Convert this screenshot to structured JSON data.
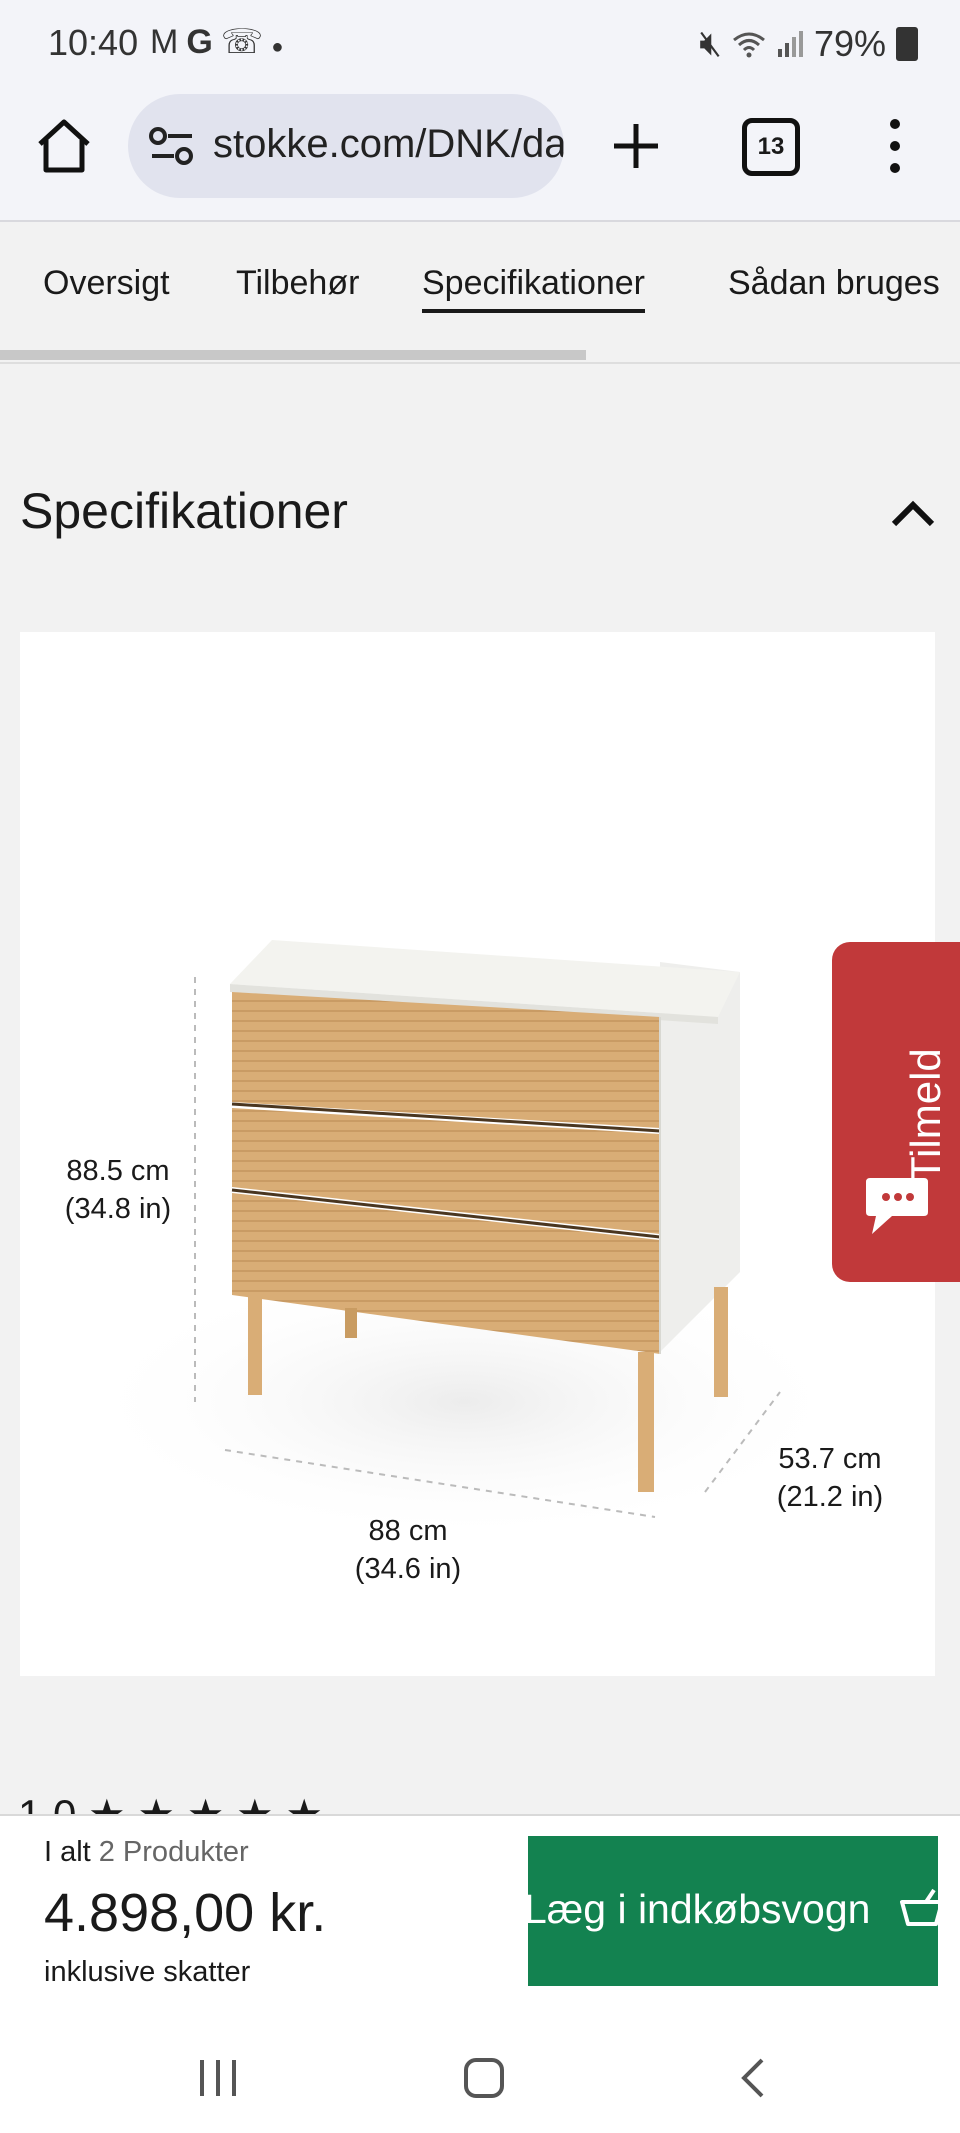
{
  "status_bar": {
    "time": "10:40",
    "left_icons": [
      "gmail-icon",
      "google-icon",
      "missed-call-icon",
      "dot-icon"
    ],
    "right_icons": [
      "mute-icon",
      "wifi-icon",
      "signal-icon"
    ],
    "battery": "79%"
  },
  "browser": {
    "url": "stokke.com/DNK/da-dk/",
    "tab_count": "13"
  },
  "tab_nav": {
    "tabs": [
      "Oversigt",
      "Tilbehør",
      "Specifikationer",
      "Sådan bruges"
    ],
    "active": "Specifikationer"
  },
  "specs": {
    "title": "Specifikationer",
    "dimensions": {
      "height": [
        "88.5 cm",
        "(34.8 in)"
      ],
      "width": [
        "88 cm",
        "(34.6 in)"
      ],
      "depth": [
        "53.7 cm",
        "(21.2 in)"
      ]
    }
  },
  "newsletter": {
    "label": "Tilmeld"
  },
  "rating_peek": "1.0 ★ ★ ★ ★ ★",
  "cart": {
    "total_label": "I alt",
    "product_count": "2 Produkter",
    "price": "4.898,00 kr.",
    "tax_note": "inklusive skatter",
    "button_label": "Læg i indkøbsvogn"
  },
  "colors": {
    "accent_green": "#138250",
    "tilmeld_red": "#c1393a",
    "oak": "#d9ad76"
  }
}
